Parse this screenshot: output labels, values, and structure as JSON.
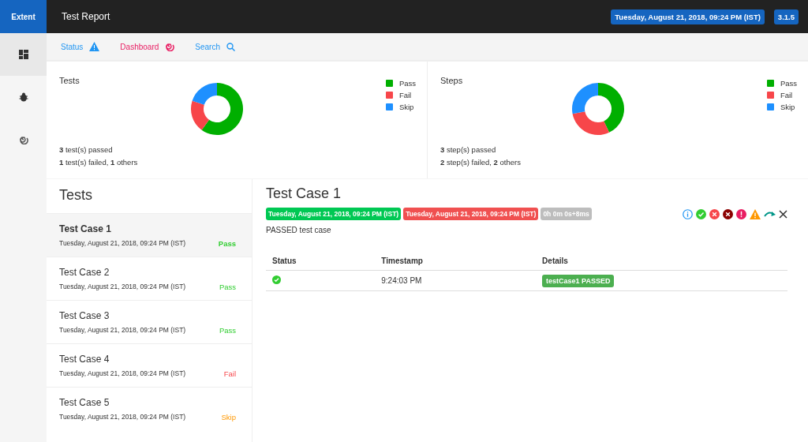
{
  "topbar": {
    "logo": "Extent",
    "title": "Test Report",
    "date": "Tuesday, August 21, 2018, 09:24 PM (IST)",
    "version": "3.1.5"
  },
  "sidebar": {
    "items": [
      {
        "kind": "dashboard",
        "selected": true
      },
      {
        "kind": "bug",
        "selected": false
      },
      {
        "kind": "spiral",
        "selected": false
      }
    ]
  },
  "nav": [
    {
      "label": "Status",
      "kind": "status"
    },
    {
      "label": "Dashboard",
      "kind": "dashboard"
    },
    {
      "label": "Search",
      "kind": "search"
    }
  ],
  "summary": [
    {
      "title": "Tests",
      "chart_data": {
        "type": "donut",
        "categories": [
          "Pass",
          "Fail",
          "Skip"
        ],
        "series": [
          {
            "values": [
              60,
              20,
              20
            ]
          }
        ]
      },
      "legend": [
        {
          "color": "#00af00"
        },
        {
          "color": "#f7464a"
        },
        {
          "color": "#1e90ff"
        }
      ],
      "lines": [
        "**3** test(s) passed",
        "**1** test(s) failed, **1** others"
      ]
    },
    {
      "title": "Steps",
      "chart_data": {
        "type": "donut",
        "categories": [
          "Pass",
          "Fail",
          "Skip"
        ],
        "series": [
          {
            "values": [
              43,
              29,
              28
            ]
          }
        ]
      },
      "legend": [
        {
          "color": "#00af00"
        },
        {
          "color": "#f7464a"
        },
        {
          "color": "#1e90ff"
        }
      ],
      "lines": [
        "**3** step(s) passed",
        "**2** step(s) failed, **2** others"
      ]
    }
  ],
  "tests": {
    "title": "Tests",
    "items": [
      {
        "name": "Test Case 1",
        "time": "Tuesday, August 21, 2018, 09:24 PM (IST)",
        "status": "Pass",
        "kind": "pass",
        "selected": true
      },
      {
        "name": "Test Case 2",
        "time": "Tuesday, August 21, 2018, 09:24 PM (IST)",
        "status": "Pass",
        "kind": "pass",
        "selected": false
      },
      {
        "name": "Test Case 3",
        "time": "Tuesday, August 21, 2018, 09:24 PM (IST)",
        "status": "Pass",
        "kind": "pass",
        "selected": false
      },
      {
        "name": "Test Case 4",
        "time": "Tuesday, August 21, 2018, 09:24 PM (IST)",
        "status": "Fail",
        "kind": "fail",
        "selected": false
      },
      {
        "name": "Test Case 5",
        "time": "Tuesday, August 21, 2018, 09:24 PM (IST)",
        "status": "Skip",
        "kind": "skip",
        "selected": false
      }
    ]
  },
  "detail": {
    "title": "Test Case 1",
    "badges": [
      {
        "text": "Tuesday, August 21, 2018, 09:24 PM (IST)",
        "kind": "start"
      },
      {
        "text": "Tuesday, August 21, 2018, 09:24 PM (IST)",
        "kind": "end"
      },
      {
        "text": "0h 0m 0s+8ms",
        "kind": "duration"
      }
    ],
    "filters": [
      {
        "kind": "info"
      },
      {
        "kind": "pass"
      },
      {
        "kind": "fail"
      },
      {
        "kind": "fatal"
      },
      {
        "kind": "error"
      },
      {
        "kind": "warning"
      },
      {
        "kind": "skip"
      },
      {
        "kind": "clear"
      }
    ],
    "description": "PASSED test case",
    "table": {
      "columns": [
        "Status",
        "Timestamp",
        "Details"
      ],
      "rows": [
        {
          "kind": "pass",
          "timestamp": "9:24:03 PM",
          "details": "testCase1 PASSED"
        }
      ]
    }
  }
}
